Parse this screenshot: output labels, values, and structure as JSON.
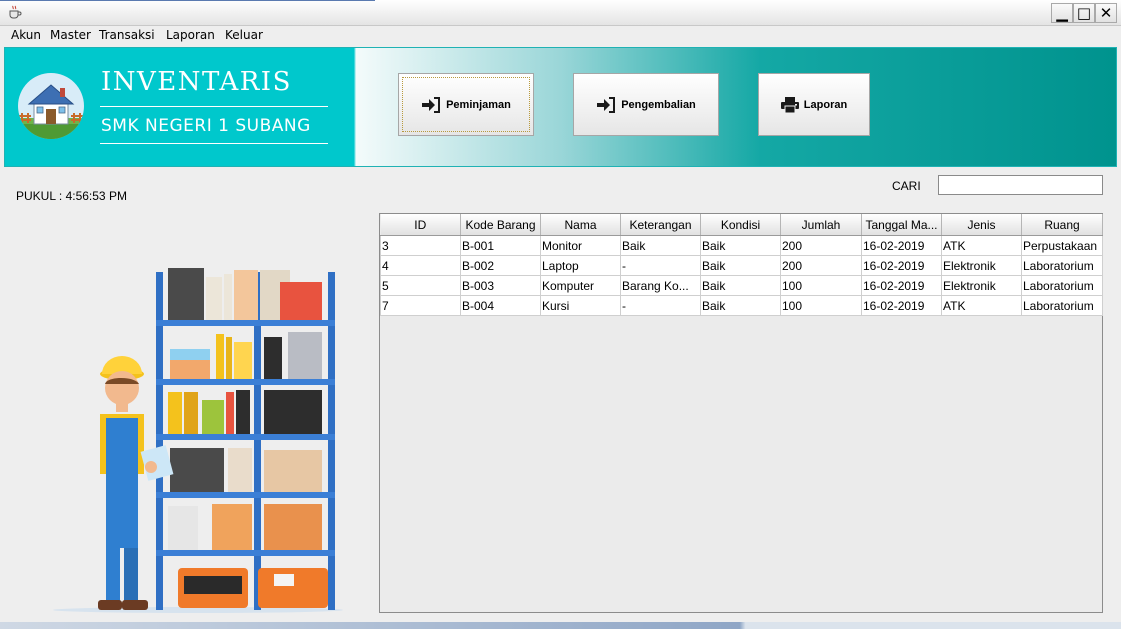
{
  "menu": [
    "Akun",
    "Master",
    "Transaksi",
    "Laporan",
    "Keluar"
  ],
  "window_controls": {
    "minimize": "▁",
    "maximize": "□",
    "close": "✕"
  },
  "banner": {
    "title": "INVENTARIS",
    "subtitle": "SMK NEGERI 1 SUBANG",
    "buttons": [
      {
        "label": "Peminjaman",
        "icon": "login-arrow-icon"
      },
      {
        "label": "Pengembalian",
        "icon": "login-arrow-icon"
      },
      {
        "label": "Laporan",
        "icon": "printer-icon"
      }
    ]
  },
  "clock": "PUKUL : 4:56:53 PM",
  "search": {
    "label": "CARI",
    "value": ""
  },
  "table": {
    "columns": [
      "ID",
      "Kode Barang",
      "Nama",
      "Keterangan",
      "Kondisi",
      "Jumlah",
      "Tanggal Ma...",
      "Jenis",
      "Ruang"
    ],
    "rows": [
      [
        "3",
        "B-001",
        "Monitor",
        "Baik",
        "Baik",
        "200",
        "16-02-2019",
        "ATK",
        "Perpustakaan"
      ],
      [
        "4",
        "B-002",
        "Laptop",
        "-",
        "Baik",
        "200",
        "16-02-2019",
        "Elektronik",
        "Laboratorium"
      ],
      [
        "5",
        "B-003",
        "Komputer",
        "Barang Ko...",
        "Baik",
        "100",
        "16-02-2019",
        "Elektronik",
        "Laboratorium"
      ],
      [
        "7",
        "B-004",
        "Kursi",
        "-",
        "Baik",
        "100",
        "16-02-2019",
        "ATK",
        "Laboratorium"
      ]
    ]
  },
  "colors": {
    "banner_accent": "#00c8cc",
    "banner_dark": "#00938e"
  }
}
